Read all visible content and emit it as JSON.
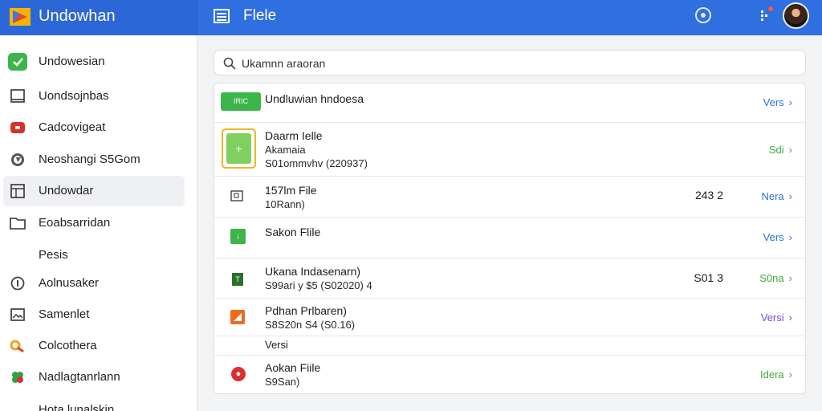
{
  "app": {
    "title": "Undowhan",
    "page_title": "Flele"
  },
  "colors": {
    "header": "#2f6fdf",
    "accent_blue": "#2a73d8",
    "accent_green": "#3eaa3f",
    "accent_purple": "#7a4ad0",
    "badge_red": "#ff5a3c"
  },
  "sidebar": {
    "items": [
      {
        "label": "Undowesian",
        "icon": "check-square-icon"
      },
      {
        "label": "Uondsojnbas",
        "icon": "square-outline-icon"
      },
      {
        "label": "Cadcovigeat",
        "icon": "red-app-icon"
      },
      {
        "label": "Neoshangi S5Gom",
        "icon": "compass-icon"
      },
      {
        "label": "Undowdar",
        "icon": "table-icon"
      },
      {
        "label": "Eoabsarridan",
        "icon": "folder-icon"
      },
      {
        "label": "Pesis",
        "icon": ""
      },
      {
        "label": "Aolnusaker",
        "icon": "info-icon"
      },
      {
        "label": "Samenlet",
        "icon": "image-icon"
      },
      {
        "label": "Colcothera",
        "icon": "key-icon"
      },
      {
        "label": "Nadlagtanrlann",
        "icon": "clover-icon"
      },
      {
        "label": "Hota lunalskin",
        "icon": ""
      }
    ]
  },
  "search": {
    "value": "Ukamnn araoran"
  },
  "rows": [
    {
      "badge": "IRIC",
      "title": "Undluwian hndoesa",
      "action": "Vers"
    },
    {
      "title": "Daarm Ielle",
      "sub": "Akamaia",
      "meta": "S01ommvhv (220937)",
      "action": "Sdi"
    },
    {
      "title": "157lm File",
      "sub": "10Rann)",
      "number": "243 2",
      "action": "Nera"
    },
    {
      "title": "Sakon Flile",
      "action": "Vers"
    },
    {
      "title": "Ukana Indasenarn)",
      "sub": "S99ari y $5 (S02020) 4",
      "number": "S01 3",
      "action": "S0na"
    },
    {
      "title": "Pdhan Prlbaren)",
      "sub": "S8S20n S4 (S0.16)",
      "action": "Versi"
    },
    {
      "title": "Versi"
    },
    {
      "title": "Aokan Fiile",
      "sub": "S9San)",
      "action": "Idera"
    }
  ]
}
